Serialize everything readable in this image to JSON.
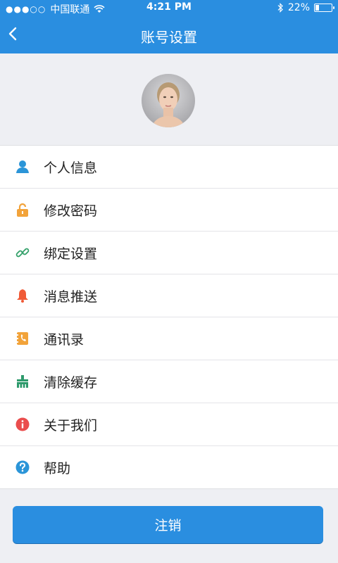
{
  "status_bar": {
    "carrier": "中国联通",
    "time": "4:21 PM",
    "battery": "22%",
    "battery_level": 0.22
  },
  "header": {
    "title": "账号设置",
    "background": "#2a8ee0"
  },
  "menu": {
    "items": [
      {
        "label": "个人信息",
        "icon": "person-icon",
        "color": "#2b95d8"
      },
      {
        "label": "修改密码",
        "icon": "lock-icon",
        "color": "#f2a33a"
      },
      {
        "label": "绑定设置",
        "icon": "link-icon",
        "color": "#35a16b"
      },
      {
        "label": "消息推送",
        "icon": "bell-icon",
        "color": "#f05a36"
      },
      {
        "label": "通讯录",
        "icon": "contacts-icon",
        "color": "#f2a33a"
      },
      {
        "label": "清除缓存",
        "icon": "brush-icon",
        "color": "#2e9a6c"
      },
      {
        "label": "关于我们",
        "icon": "info-icon",
        "color": "#ea4d4d"
      },
      {
        "label": "帮助",
        "icon": "help-icon",
        "color": "#2b95d8"
      }
    ]
  },
  "logout": {
    "label": "注销"
  }
}
